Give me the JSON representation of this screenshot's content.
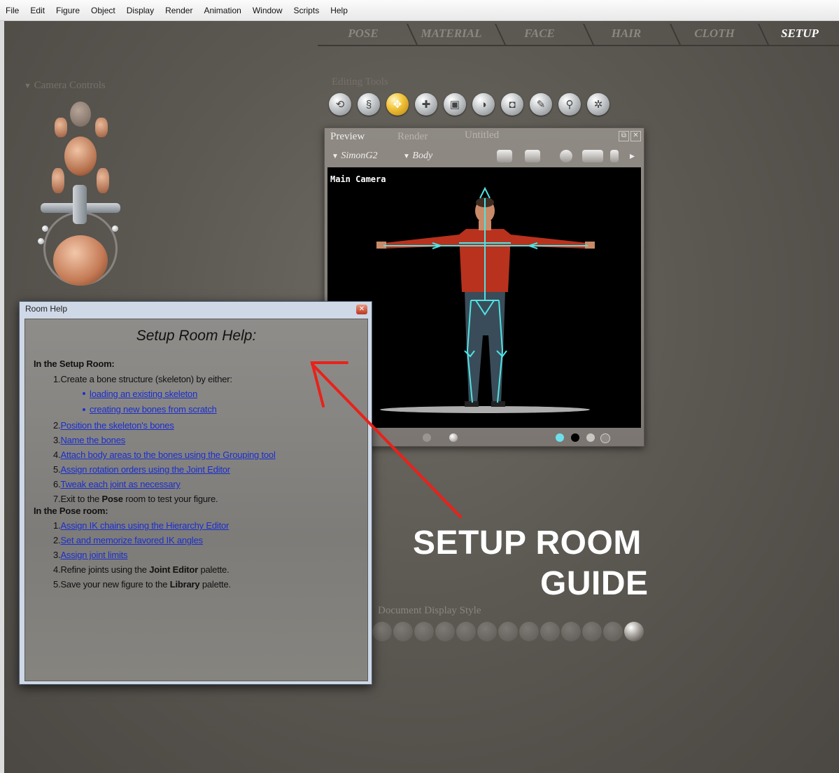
{
  "menu": [
    "File",
    "Edit",
    "Figure",
    "Object",
    "Display",
    "Render",
    "Animation",
    "Window",
    "Scripts",
    "Help"
  ],
  "room_tabs": [
    "POSE",
    "MATERIAL",
    "FACE",
    "HAIR",
    "CLOTH",
    "SETUP"
  ],
  "active_room": "SETUP",
  "camera_controls_label": "Camera Controls",
  "editing_tools_label": "Editing Tools",
  "editing_tools": [
    "rotate",
    "twist",
    "translate",
    "translate-in-out",
    "scale",
    "taper",
    "chain-break",
    "color",
    "grouping",
    "direct-manipulation"
  ],
  "preview": {
    "tabs": [
      "Preview",
      "Render",
      "Untitled"
    ],
    "figure": "SimonG2",
    "actor": "Body",
    "camera_label": "Main Camera"
  },
  "help": {
    "window_title": "Room Help",
    "heading": "Setup Room Help:",
    "section1": "In the Setup Room:",
    "step1_num": "1.",
    "step1": "Create a bone structure (skeleton) by either:",
    "bullet1": "loading an existing skeleton",
    "bullet2": "creating new bones from scratch",
    "link2": "Position the skeleton's bones",
    "link3": "Name the bones",
    "link4": "Attach body areas to the bones using the Grouping tool",
    "link5": "Assign rotation orders using the Joint Editor",
    "link6": "Tweak each joint as necessary",
    "step7_pre": "Exit to the",
    "step7_bold": "Pose",
    "step7_post": "room to test your figure.",
    "section2": "In the Pose room:",
    "pose1": "Assign IK chains using the Hierarchy Editor",
    "pose2": "Set and memorize favored IK angles",
    "pose3": "Assign joint limits",
    "pose4_pre": "Refine joints using the",
    "pose4_bold": "Joint Editor",
    "pose4_post": "palette.",
    "pose5_pre": "Save your new figure to the",
    "pose5_bold": "Library",
    "pose5_post": "palette."
  },
  "doc_display_label": "Document Display Style",
  "overlay_title_line1": "SETUP ROOM",
  "overlay_title_line2": "GUIDE",
  "colors": {
    "link": "#1a2ed0",
    "arrow": "#e8221a",
    "skeleton": "#4fe3e3",
    "shirt": "#b8321e"
  }
}
